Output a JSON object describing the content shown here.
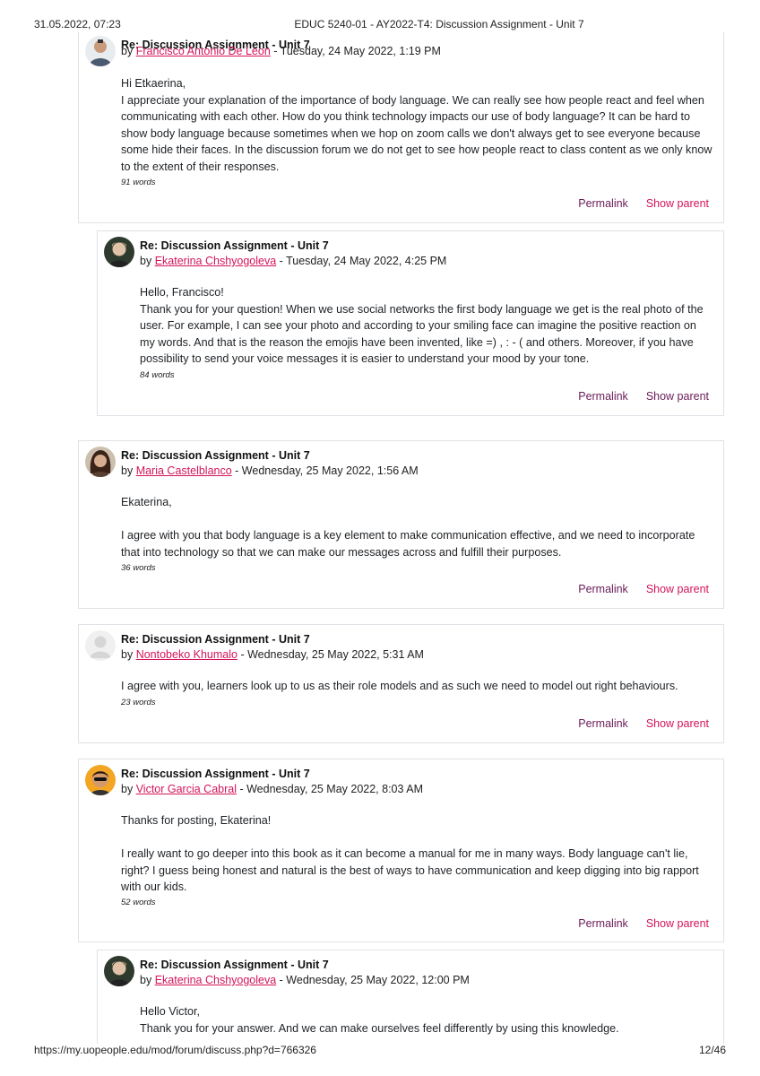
{
  "pdf_header": {
    "datetime": "31.05.2022, 07:23",
    "title": "EDUC 5240-01 - AY2022-T4: Discussion Assignment - Unit 7"
  },
  "pdf_footer": {
    "url": "https://my.uopeople.edu/mod/forum/discuss.php?d=766326",
    "page": "12/46"
  },
  "posts": [
    {
      "subject": "Re: Discussion Assignment - Unit 7",
      "by": "by",
      "author": "Francisco Antonio De Leon",
      "date": " - Tuesday, 24 May 2022, 1:19 PM",
      "paragraphs": [
        "Hi Etkaerina,",
        "I appreciate your explanation of the importance of body language. We can really see how people react and feel when communicating with each other. How do you think technology impacts our use of body language? It can be hard to show body language because sometimes when we hop on zoom calls we don't always get to see everyone because some hide their faces. In the discussion forum we do not get to see how people react to class content as we only know to the extent of their responses."
      ],
      "word_count": "91 words",
      "permalink": "Permalink",
      "show_parent": "Show parent"
    },
    {
      "subject": "Re: Discussion Assignment - Unit 7",
      "by": "by",
      "author": "Ekaterina Chshyogoleva",
      "date": " - Tuesday, 24 May 2022, 4:25 PM",
      "paragraphs": [
        "Hello, Francisco!",
        "Thank you for your question! When we use social networks the first body language we get is the real photo of the user. For example, I can see your photo and according to your smiling face can imagine the positive reaction on my words. And that is the reason the emojis have been invented, like =) , : - ( and others. Moreover, if you have possibility to send your voice messages it is easier to understand your mood by your tone."
      ],
      "word_count": "84 words",
      "permalink": "Permalink",
      "show_parent": "Show parent"
    },
    {
      "subject": "Re: Discussion Assignment - Unit 7",
      "by": "by",
      "author": "Maria Castelblanco",
      "date": " - Wednesday, 25 May 2022, 1:56 AM",
      "paragraphs": [
        "Ekaterina,",
        "",
        "I agree with you that body language is a key element to make communication effective, and we need to incorporate that into technology so that we can make our messages across and fulfill their purposes."
      ],
      "word_count": "36 words",
      "permalink": "Permalink",
      "show_parent": "Show parent"
    },
    {
      "subject": "Re: Discussion Assignment - Unit 7",
      "by": "by",
      "author": "Nontobeko Khumalo",
      "date": " - Wednesday, 25 May 2022, 5:31 AM",
      "paragraphs": [
        "I agree with you, learners look up to us as their role models and as such we need to model out right behaviours."
      ],
      "word_count": "23 words",
      "permalink": "Permalink",
      "show_parent": "Show parent"
    },
    {
      "subject": "Re: Discussion Assignment - Unit 7",
      "by": "by",
      "author": "Victor Garcia Cabral",
      "date": " - Wednesday, 25 May 2022, 8:03 AM",
      "paragraphs": [
        "Thanks for posting, Ekaterina!",
        "",
        "I really want to go deeper into this book as it can become a manual for me in many ways. Body language can't lie, right? I guess being honest and natural is the best of ways to have communication and keep digging into big rapport with our kids."
      ],
      "word_count": "52 words",
      "permalink": "Permalink",
      "show_parent": "Show parent"
    },
    {
      "subject": "Re: Discussion Assignment - Unit 7",
      "by": "by",
      "author": "Ekaterina Chshyogoleva",
      "date": " - Wednesday, 25 May 2022, 12:00 PM",
      "paragraphs": [
        "Hello Victor,",
        "Thank you for your answer. And we can make ourselves feel differently by using this knowledge."
      ]
    }
  ]
}
